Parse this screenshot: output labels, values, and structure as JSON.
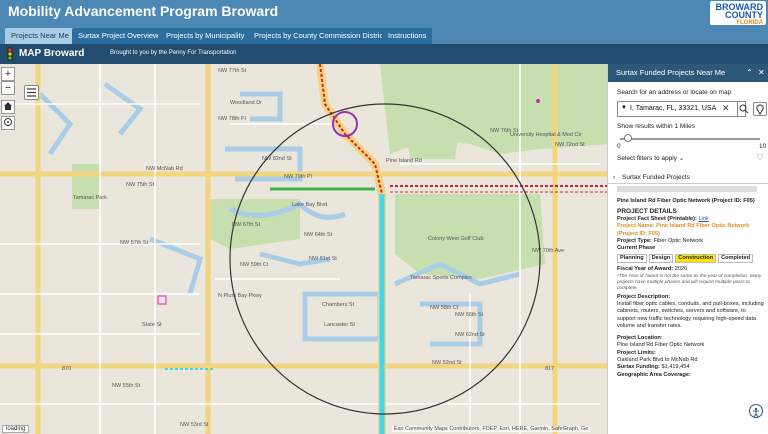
{
  "header": {
    "title": "Mobility Advancement Program Broward",
    "logo": {
      "line1": "BROWARD",
      "line2": "COUNTY",
      "line3": "FLORIDA"
    }
  },
  "tabs": [
    {
      "label": "Projects Near Me",
      "active": true
    },
    {
      "label": "Surtax Project Overview",
      "active": false
    },
    {
      "label": "Projects by Municipality",
      "active": false
    },
    {
      "label": "Projects by County Commission District",
      "active": false
    },
    {
      "label": "Instructions",
      "active": false
    }
  ],
  "appbar": {
    "name": "MAP Broward",
    "subtitle": "Brought to you by the Penny For Transportation"
  },
  "map": {
    "zoom_in": "+",
    "zoom_out": "−",
    "attribution": "Esri Community Maps Contributors, FDEP, Esri, HERE, Garmin, SafeGraph, Ge",
    "loading": "loading",
    "street_labels": [
      "NW 77th St",
      "NW 78th Pl",
      "NW 76th St",
      "NW McNab Rd",
      "NW 72nd St",
      "Woodland Dr",
      "NW 82nd St",
      "NW 79th Pl",
      "NW 75th St",
      "Lake Bay Blvd",
      "NW 67th St",
      "NW 64th St",
      "NW 61st St",
      "NW 59th Ct",
      "NW 57th St",
      "NW 58th Ct",
      "N Plum Bay Pkwy",
      "Chambers St",
      "Lancaster St",
      "State St",
      "NW 55th St",
      "NW 52nd St",
      "NW 53rd St",
      "NW 66th St",
      "NW 62nd St",
      "Tamarac Park",
      "Tamarac Sports Complex",
      "University Hospital & Med Ctr",
      "Colony West Golf Club",
      "NW 70th Ave",
      "Pine Island Rd",
      "870",
      "817"
    ]
  },
  "panel": {
    "title": "Surtax Funded Projects Near Me",
    "search_label": "Search for an address or locate on map",
    "search_value": "I, Tamarac, FL, 33321, USA",
    "radius_label": "Show results within 1 Miles",
    "slider": {
      "min": "0",
      "max": "10",
      "value": 1
    },
    "filters_label": "Select filters to apply",
    "breadcrumb": "Surtax Funded Projects",
    "project_header": "Pine Island Rd Fiber Optic Network (Project ID: F05)",
    "details_title": "PROJECT DETAILS",
    "fact_sheet_label": "Project Fact Sheet (Printable): ",
    "fact_sheet_link": "Link",
    "project_name": "Project Name: Pine Island Rd Fiber Optic Network (Project ID: F05)",
    "project_type_label": "Project Type: ",
    "project_type": "Fiber Optic Network",
    "current_phase_label": "Current Phase",
    "phases": [
      {
        "label": "Planning",
        "active": false
      },
      {
        "label": "Design",
        "active": false
      },
      {
        "label": "Construction",
        "active": true
      },
      {
        "label": "Completed",
        "active": false
      }
    ],
    "fiscal_year_label": "Fiscal Year of Award: ",
    "fiscal_year": "2020",
    "fiscal_note": "*The Year of Award is not the same as the year of completion. Many projects have multiple phases and will require multiple years to complete.",
    "description_label": "Project Description:",
    "description": "Install fiber optic cables, conduits, and pull-boxes, including cabinets, routers, switches, servers and software, to support new traffic technology requiring high-speed data volume and transfer rates.",
    "location_label": "Project Location:",
    "location": "Pine Island Rd Fiber Optic Network",
    "limits_label": "Project Limits:",
    "limits": "Oakland Park Blvd to McNab Rd",
    "funding_label": "Surtax Funding: ",
    "funding": "$1,419,454",
    "coverage_label": "Geographic Area Coverage:"
  }
}
